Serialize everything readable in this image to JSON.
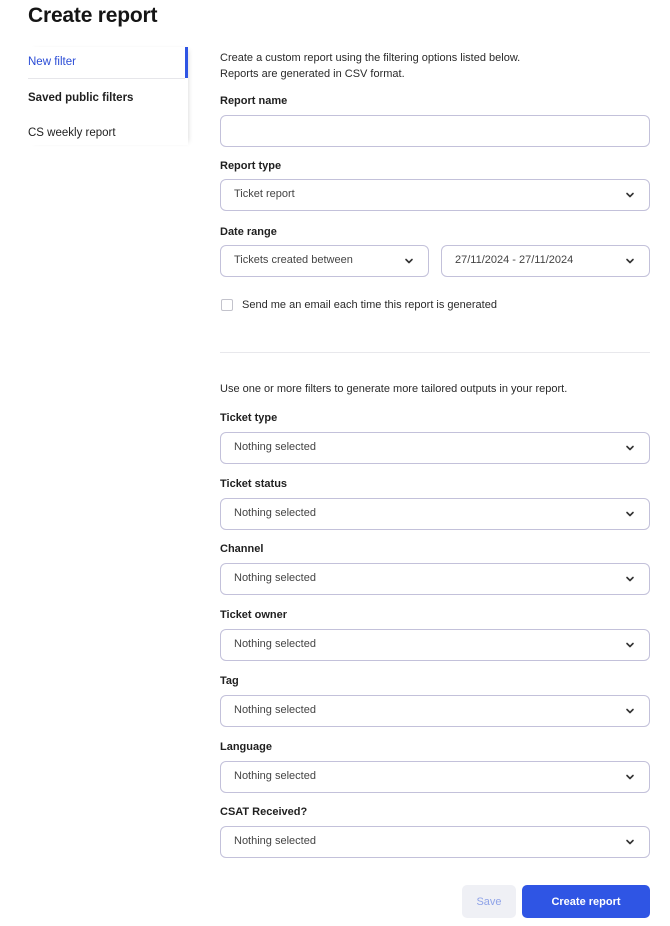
{
  "page": {
    "title": "Create report"
  },
  "sidebar": {
    "items": [
      {
        "label": "New filter",
        "active": true
      },
      {
        "label": "Saved public filters",
        "heading": true
      },
      {
        "label": "CS weekly report"
      }
    ]
  },
  "form": {
    "intro_line1": "Create a custom report using the filtering options listed below.",
    "intro_line2": "Reports are generated in CSV format.",
    "report_name": {
      "label": "Report name",
      "value": ""
    },
    "report_type": {
      "label": "Report type",
      "value": "Ticket report"
    },
    "date_range": {
      "label": "Date range",
      "mode": "Tickets created between",
      "range": "27/11/2024 - 27/11/2024"
    },
    "email_checkbox": {
      "label": "Send me an email each time this report is generated",
      "checked": false
    },
    "filters_intro": "Use one or more filters to generate more tailored outputs in your report.",
    "filters": [
      {
        "label": "Ticket type",
        "value": "Nothing selected"
      },
      {
        "label": "Ticket status",
        "value": "Nothing selected"
      },
      {
        "label": "Channel",
        "value": "Nothing selected"
      },
      {
        "label": "Ticket owner",
        "value": "Nothing selected"
      },
      {
        "label": "Tag",
        "value": "Nothing selected"
      },
      {
        "label": "Language",
        "value": "Nothing selected"
      },
      {
        "label": "CSAT Received?",
        "value": "Nothing selected"
      }
    ]
  },
  "actions": {
    "save_label": "Save",
    "create_label": "Create report"
  },
  "icons": {
    "chevron": "chevron-down-icon",
    "checkbox": "checkbox-unchecked"
  },
  "colors": {
    "accent": "#2f55e4",
    "border": "#c3c1da",
    "save_bg": "#eff0f5",
    "save_text": "#8fa3e8"
  }
}
